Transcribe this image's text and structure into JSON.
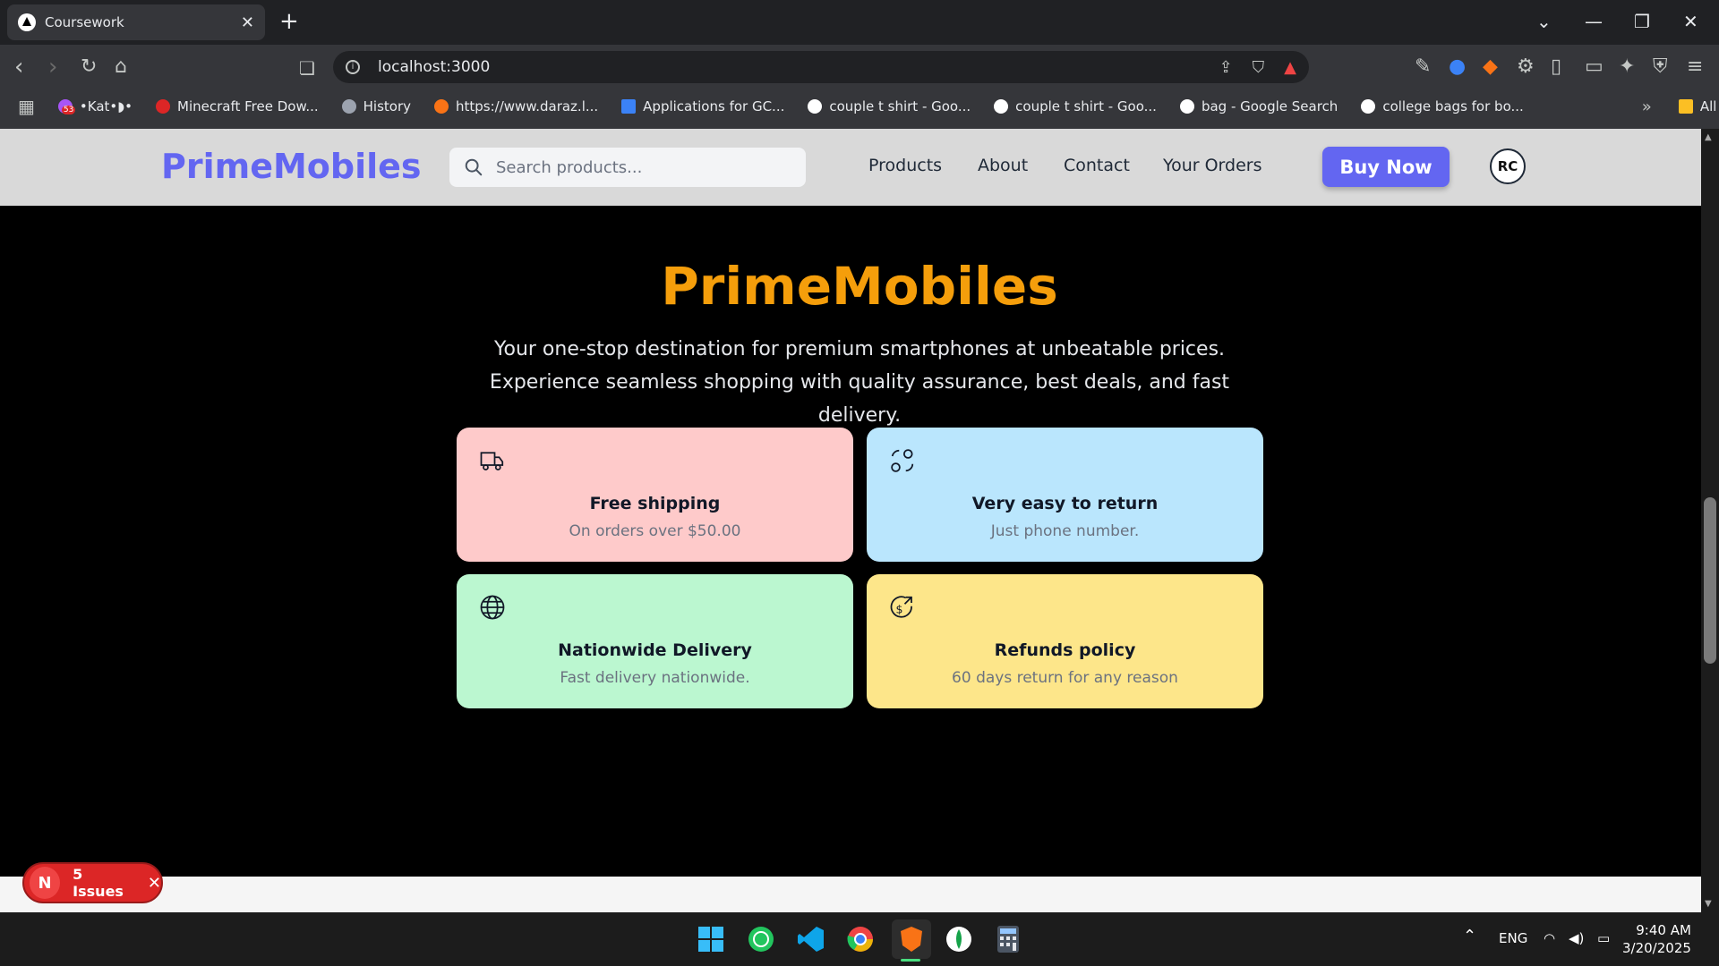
{
  "browser": {
    "tab_title": "Coursework",
    "new_tab": "+",
    "url": "localhost:3000",
    "bookmarks": [
      {
        "label": "•Kat•◗•",
        "color": "#a855f7"
      },
      {
        "label": "Minecraft Free Dow...",
        "color": "#dc2626"
      },
      {
        "label": "History",
        "color": "#9ca3af"
      },
      {
        "label": "https://www.daraz.l...",
        "color": "#f97316"
      },
      {
        "label": "Applications for GC...",
        "color": "#3b82f6"
      },
      {
        "label": "couple t shirt - Goo...",
        "color": "#ffffff"
      },
      {
        "label": "couple t shirt - Goo...",
        "color": "#ffffff"
      },
      {
        "label": "bag - Google Search",
        "color": "#ffffff"
      },
      {
        "label": "college bags for bo...",
        "color": "#ffffff"
      }
    ],
    "bookmark_badge": "53",
    "all_bookmarks": "All Bookmarks"
  },
  "header": {
    "brand": "PrimeMobiles",
    "search_placeholder": "Search products...",
    "nav": [
      "Products",
      "About",
      "Contact",
      "Your Orders"
    ],
    "buy_now": "Buy Now",
    "avatar": "RC"
  },
  "hero": {
    "title": "PrimeMobiles",
    "subtitle": "Your one-stop destination for premium smartphones at unbeatable prices. Experience seamless shopping with quality assurance, best deals, and fast delivery."
  },
  "features": [
    {
      "title": "Free shipping",
      "text": "On orders over $50.00",
      "icon": "truck-icon",
      "color": "#fecaca"
    },
    {
      "title": "Very easy to return",
      "text": "Just phone number.",
      "icon": "return-icon",
      "color": "#bae6fd"
    },
    {
      "title": "Nationwide Delivery",
      "text": "Fast delivery nationwide.",
      "icon": "globe-icon",
      "color": "#bbf7d0"
    },
    {
      "title": "Refunds policy",
      "text": "60 days return for any reason",
      "icon": "refund-icon",
      "color": "#fde68a"
    }
  ],
  "dev_overlay": {
    "badge": "N",
    "issues": "5 Issues"
  },
  "taskbar": {
    "lang": "ENG",
    "time": "9:40 AM",
    "date": "3/20/2025"
  }
}
